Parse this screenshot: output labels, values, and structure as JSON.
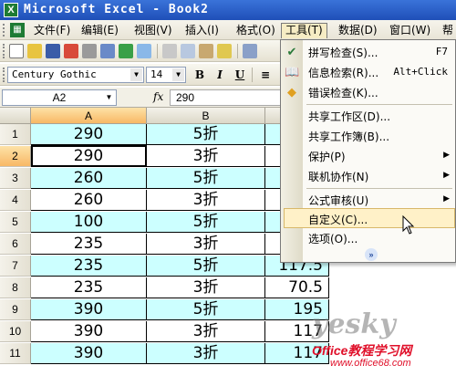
{
  "window": {
    "title": "Microsoft Excel - Book2",
    "app_icon": "X"
  },
  "menubar": {
    "items": [
      "文件(F)",
      "编辑(E)",
      "视图(V)",
      "插入(I)",
      "格式(O)",
      "工具(T)",
      "数据(D)",
      "窗口(W)",
      "帮"
    ],
    "active": "工具(T)"
  },
  "toolbar": {
    "font_name": "Century Gothic",
    "font_size": "14",
    "bold": "B",
    "italic": "I",
    "underline": "U"
  },
  "formula_bar": {
    "name_box": "A2",
    "fx": "fx",
    "value": "290"
  },
  "sheet": {
    "columns": [
      "A",
      "B",
      "C"
    ],
    "selected_column": "A",
    "rows": [
      {
        "num": "1",
        "a": "290",
        "b": "5折",
        "c": ""
      },
      {
        "num": "2",
        "a": "290",
        "b": "3折",
        "c": ""
      },
      {
        "num": "3",
        "a": "260",
        "b": "5折",
        "c": ""
      },
      {
        "num": "4",
        "a": "260",
        "b": "3折",
        "c": ""
      },
      {
        "num": "5",
        "a": "100",
        "b": "5折",
        "c": ""
      },
      {
        "num": "6",
        "a": "235",
        "b": "3折",
        "c": ""
      },
      {
        "num": "7",
        "a": "235",
        "b": "5折",
        "c": "117.5"
      },
      {
        "num": "8",
        "a": "235",
        "b": "3折",
        "c": "70.5"
      },
      {
        "num": "9",
        "a": "390",
        "b": "5折",
        "c": "195"
      },
      {
        "num": "10",
        "a": "390",
        "b": "3折",
        "c": "117"
      },
      {
        "num": "11",
        "a": "390",
        "b": "3折",
        "c": "117"
      }
    ],
    "selected_row": "2",
    "active_cell": "A2"
  },
  "tools_menu": {
    "items": [
      {
        "label": "拼写检查(S)...",
        "shortcut": "F7",
        "icon": "spellcheck-icon"
      },
      {
        "label": "信息检索(R)...",
        "shortcut": "Alt+Click",
        "icon": "research-icon"
      },
      {
        "label": "错误检查(K)...",
        "shortcut": "",
        "icon": "error-check-icon"
      },
      {
        "label": "共享工作区(D)...",
        "shortcut": ""
      },
      {
        "label": "共享工作簿(B)...",
        "shortcut": ""
      },
      {
        "label": "保护(P)",
        "submenu": true
      },
      {
        "label": "联机协作(N)",
        "submenu": true
      },
      {
        "label": "公式审核(U)",
        "submenu": true
      },
      {
        "label": "自定义(C)...",
        "highlight": true
      },
      {
        "label": "选项(O)..."
      }
    ],
    "expand_icon": "chevron-double-down-icon"
  },
  "watermark": {
    "brand": "yesky",
    "site_cn": "Office教程学习网",
    "url": "www.office68.com"
  },
  "colors": {
    "cyan_fill": "#ccffff",
    "title_blue": "#1f4fb8",
    "highlight": "#fff1c8",
    "header_selected": "#f8b865"
  }
}
